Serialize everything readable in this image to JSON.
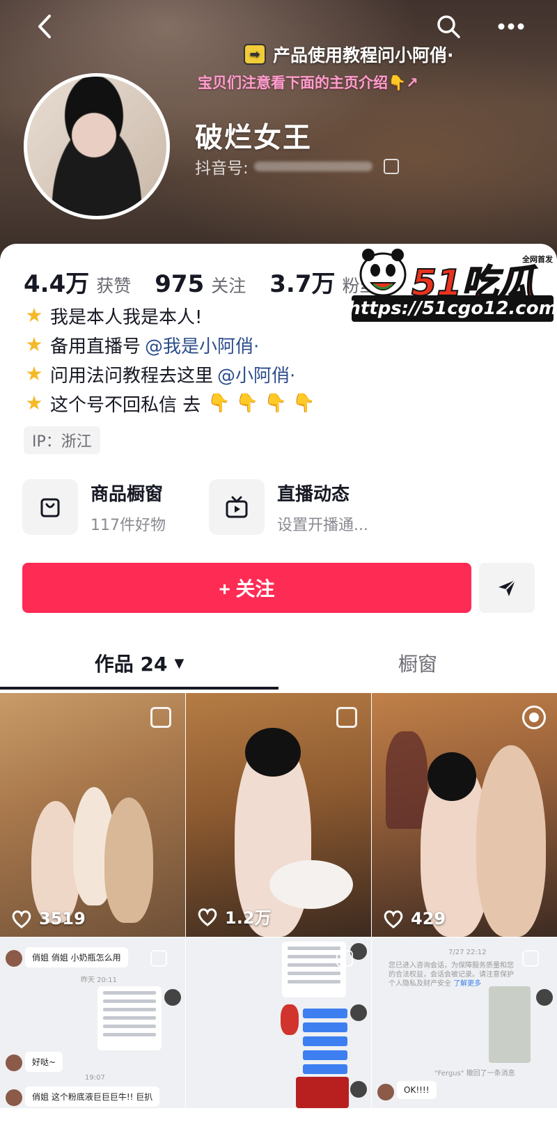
{
  "header": {
    "promo_line_1": "产品使用教程问小阿俏·",
    "promo_line_2": "宝贝们注意看下面的主页介绍👇↗",
    "nickname": "破烂女王",
    "douyin_id_label": "抖音号:"
  },
  "stats": [
    {
      "value": "4.4万",
      "label": "获赞"
    },
    {
      "value": "975",
      "label": "关注"
    },
    {
      "value": "3.7万",
      "label": "粉丝"
    }
  ],
  "watermark": {
    "brand": "51吃瓜",
    "tag": "全网首发",
    "url": "https://51cgo12.com"
  },
  "bio": {
    "line1": "我是本人我是本人!",
    "line2_text": "备用直播号",
    "line2_mention": "@我是小阿俏·",
    "line3_text": "问用法问教程去这里",
    "line3_mention": "@小阿俏·",
    "line4_text": "这个号不回私信 去"
  },
  "ip": "IP：浙江",
  "entries": {
    "shop_title": "商品橱窗",
    "shop_sub": "117件好物",
    "live_title": "直播动态",
    "live_sub": "设置开播通..."
  },
  "actions": {
    "follow_label": "+ 关注"
  },
  "tabs": {
    "works_label": "作品 24",
    "shop_label": "橱窗"
  },
  "videos": [
    {
      "likes": "3519"
    },
    {
      "likes": "1.2万"
    },
    {
      "likes": "429"
    }
  ],
  "chats": {
    "c1_msg1": "俏姐 俏姐 小奶瓶怎么用",
    "c1_time1": "昨天 20:11",
    "c1_msg2": "好哒~",
    "c1_time2": "19:07",
    "c1_msg3": "俏姐 这个粉底液巨巨巨牛!! 巨扒",
    "c3_time": "7/27 22:12",
    "c3_notice": "您已进入咨询会话，为保障服务质量和您的合法权益，会话会被记录。请注意保护个人隐私及财产安全",
    "c3_link": "了解更多",
    "c3_recall": "\"Fergus\" 撤回了一条消息",
    "c3_msg": "OK!!!!"
  },
  "colors": {
    "accent": "#fe2c55",
    "mention": "#2d4d8c",
    "promo_pink": "#ff9fcf"
  }
}
